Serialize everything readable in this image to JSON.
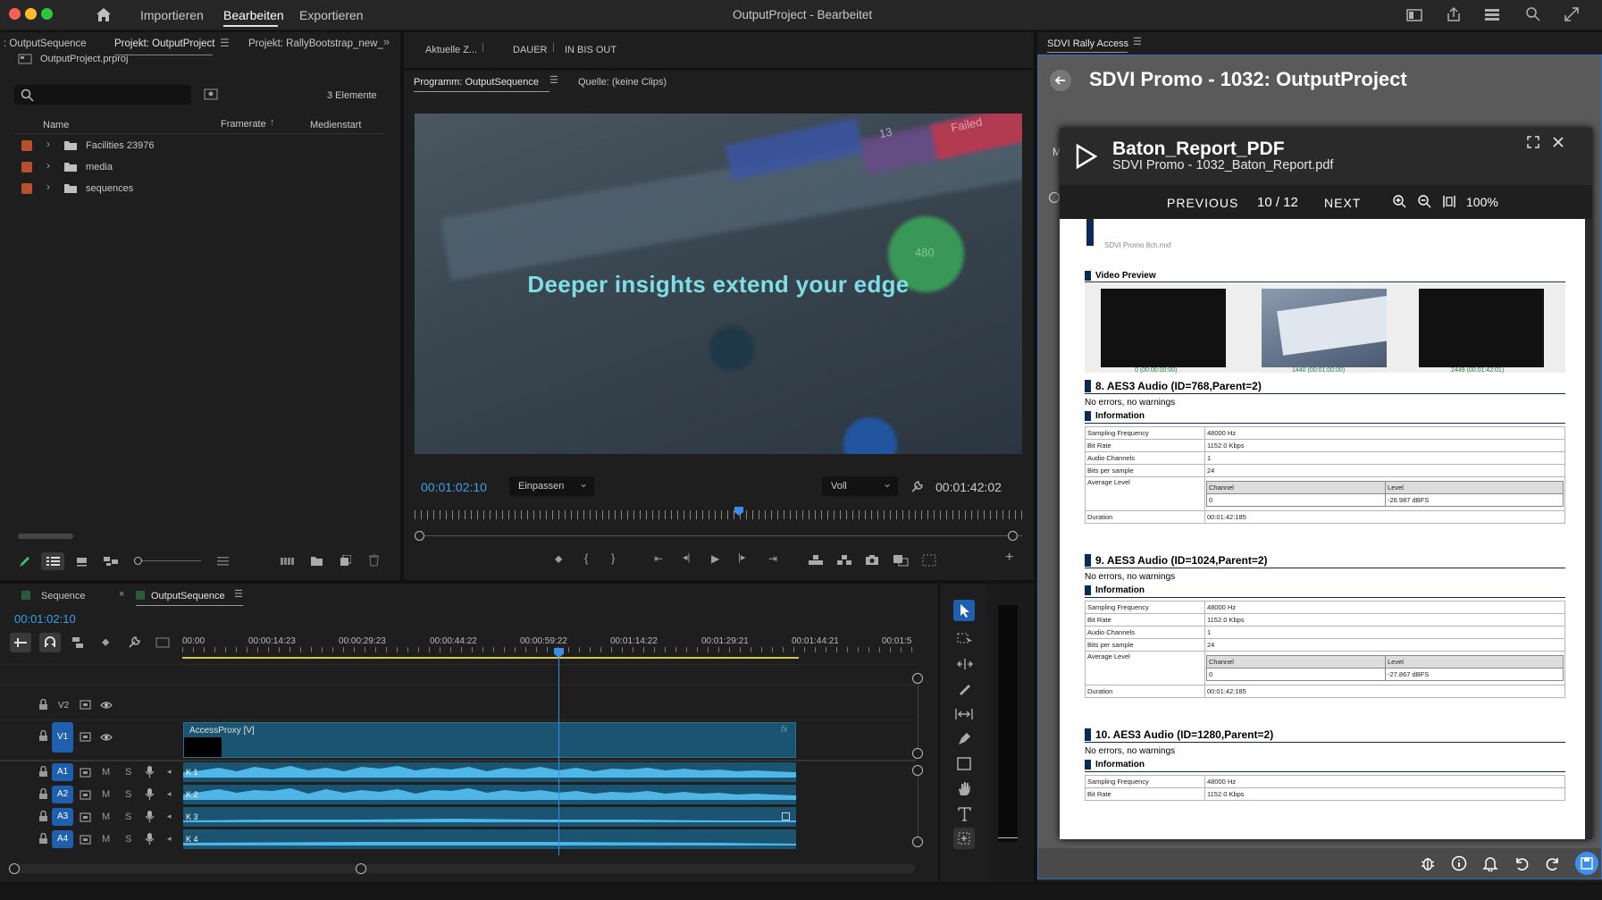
{
  "titlebar": {
    "menu": [
      "Importieren",
      "Bearbeiten",
      "Exportieren"
    ],
    "title": "OutputProject - Bearbeitet"
  },
  "project_panel": {
    "tabs": [
      ": OutputSequence",
      "Projekt: OutputProject",
      "Projekt: RallyBootstrap_new_"
    ],
    "file": "OutputProject.prproj",
    "count": "3 Elemente",
    "columns": [
      "Name",
      "Framerate",
      "Medienstart"
    ],
    "items": [
      "Facilities 23976",
      "media",
      "sequences"
    ]
  },
  "mid_strip": {
    "labels": [
      "Aktuelle Z...",
      "DAUER",
      "IN BIS OUT"
    ]
  },
  "program_monitor": {
    "tabs": [
      "Programm: OutputSequence",
      "Quelle: (keine Clips)"
    ],
    "overlay_text": "Deeper insights extend your edge",
    "video_badges": [
      "Failed",
      "13",
      "480"
    ],
    "timecode_left": "00:01:02:10",
    "fit": "Einpassen",
    "quality": "Voll",
    "timecode_right": "00:01:42:02"
  },
  "timeline": {
    "tabs": [
      "Sequence",
      "OutputSequence"
    ],
    "timecode": "00:01:02:10",
    "ruler": [
      "00:00",
      "00:00:14:23",
      "00:00:29:23",
      "00:00:44:22",
      "00:00:59:22",
      "00:01:14:22",
      "00:01:29:21",
      "00:01:44:21",
      "00:01:5"
    ],
    "video_tracks": [
      "V2",
      "V1"
    ],
    "audio_tracks": [
      "A1",
      "A2",
      "A3",
      "A4"
    ],
    "ms": [
      "M",
      "S"
    ],
    "clip_video": "AccessProxy [V]",
    "fx": "fx",
    "clip_audio": [
      "K 1",
      "K 2",
      "K 3",
      "K 4"
    ]
  },
  "rally": {
    "panel_title": "SDVI Rally Access",
    "header": "SDVI Promo - 1032: OutputProject",
    "side_letter": "M",
    "viewer": {
      "title": "Baton_Report_PDF",
      "subtitle": "SDVI Promo - 1032_Baton_Report.pdf",
      "prev": "PREVIOUS",
      "page": "10 / 12",
      "next": "NEXT",
      "zoom": "100%"
    },
    "doc": {
      "filename": "SDVI Promo 8ch.mxf",
      "video_preview": "Video Preview",
      "thumbs": [
        "0 (00:00:00:00)",
        "1440 (00:01:00:00)",
        "2449 (00:01:42:01)"
      ],
      "no_errors": "No errors, no warnings",
      "info": "Information",
      "keys": [
        "Sampling Frequency",
        "Bit Rate",
        "Audio Channels",
        "Bits per sample",
        "Average Level",
        "Duration"
      ],
      "freq": "48000 Hz",
      "bitrate": "1152.0 Kbps",
      "channels": "1",
      "bits": "24",
      "col_channel": "Channel",
      "col_level": "Level",
      "chan0": "0",
      "duration": "00:01:42:185",
      "sections": [
        {
          "title": "8. AES3 Audio (ID=768,Parent=2)",
          "level": "-26.987 dBFS"
        },
        {
          "title": "9. AES3 Audio (ID=1024,Parent=2)",
          "level": "-27.867 dBFS"
        },
        {
          "title": "10. AES3 Audio (ID=1280,Parent=2)"
        }
      ]
    }
  },
  "colors": {
    "accent": "#3b8ff0",
    "timecode": "#3aa0e8",
    "teal": "#7fdde6",
    "navy": "#0b2a55"
  }
}
